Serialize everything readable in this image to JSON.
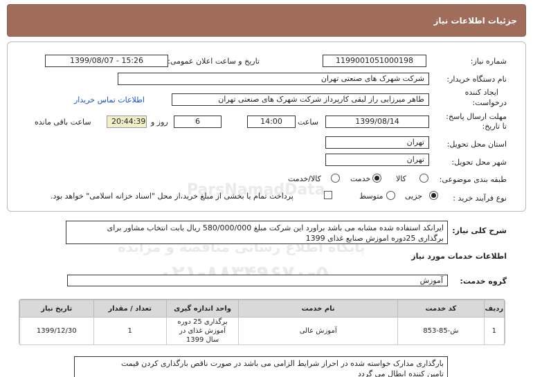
{
  "header": {
    "title": "جزئیات اطلاعات نیاز"
  },
  "form": {
    "need_number_label": "شماره نیاز:",
    "need_number": "1199001051000198",
    "announce_label": "تاریخ و ساعت اعلان عمومی:",
    "announce_value": "1399/08/07 - 15:26",
    "buyer_label": "نام دستگاه خریدار:",
    "buyer_value": "شرکت شهرک های صنعتی تهران",
    "creator_label_1": "ایجاد کننده",
    "creator_label_2": "درخواست:",
    "creator_value": "طاهر  میرزایی راز لیقی کارپرداز  شرکت شهرک های صنعتی تهران",
    "contact_link": "اطلاعات تماس خریدار",
    "deadline_label_1": "مهلت ارسال پاسخ:",
    "deadline_label_2": "تا تاریخ:",
    "deadline_date": "1399/08/14",
    "time_label": "ساعت",
    "deadline_time": "14:00",
    "days_value": "6",
    "days_label": "روز و",
    "remaining_time": "20:44:39",
    "remaining_label": "ساعت باقی مانده",
    "province_label": "استان محل تحویل:",
    "province_value": "تهران",
    "city_label": "شهر محل تحویل:",
    "city_value": "تهران",
    "category_label": "طبقه بندی موضوعی:",
    "category_options": [
      "کالا",
      "خدمت",
      "کالا/خدمت"
    ],
    "category_selected": "خدمت",
    "process_label": "نوع فرآیند خرید :",
    "process_options": [
      "جزیی",
      "متوسط"
    ],
    "process_selected": "جزیی",
    "payment_note": "پرداخت تمام یا بخشی از مبلغ خرید،از محل \"اسناد خزانه اسلامی\" خواهد بود."
  },
  "summary": {
    "label": "شرح کلی نیاز:",
    "line1": "ایرانکد استفاده شده مشابه می باشد براورد این شرکت مبلغ 580/000/000 ریال بابت انتخاب مشاور برای",
    "line2": "برگذاری  25دوره اموزش صنایع غذای 1399"
  },
  "services": {
    "section_title": "اطلاعات خدمات مورد نیاز",
    "group_label": "گروه خدمت:",
    "group_value": "آموزش",
    "columns": [
      "ردیف",
      "کد خدمت",
      "نام خدمت",
      "واحد اندازه گیری",
      "تعداد / مقدار",
      "تاریخ نیاز"
    ],
    "rows": [
      {
        "row": "1",
        "code": "ش-85-853",
        "name": "آموزش عالی",
        "unit": "برگذاری 25 دوره آموزش غذای در سال 1399",
        "qty": "1",
        "date": "1399/12/30"
      }
    ]
  },
  "notes": {
    "line1": "بارگذاری مدارک خواسته شده در احراز شرایط الزامی می باشد در صورت ناقص بارگذاری کردن قیمت",
    "line2": "تامین کننده ابطال می گردد"
  },
  "watermark": {
    "brand": "ParsNamadData",
    "line1": "پایگاه اطلاع رسانی مناقصه و مزایده",
    "line2": "۰۲۱-۸۸۳۴۹۶۷۰-۵"
  }
}
